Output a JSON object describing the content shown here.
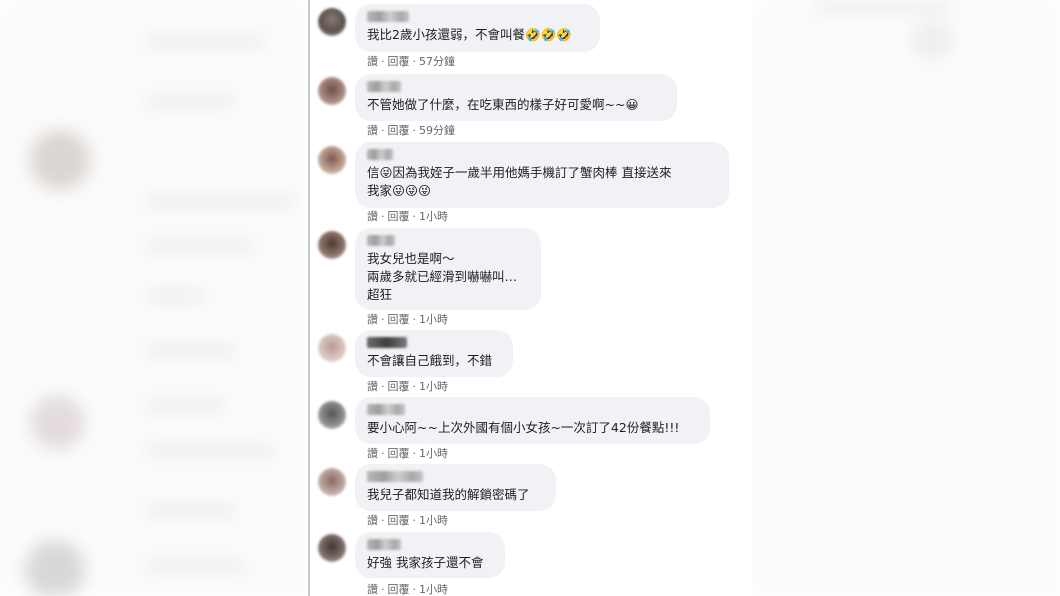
{
  "comments": [
    {
      "text": "我比2歲小孩還弱，不會叫餐🤣🤣🤣",
      "like": "讚",
      "reply": "回覆",
      "time": "57分鐘"
    },
    {
      "text": "不管她做了什麼，在吃東西的樣子好可愛啊~~😀",
      "like": "讚",
      "reply": "回覆",
      "time": "59分鐘"
    },
    {
      "text": "信😜因為我姪子一歲半用他媽手機訂了蟹肉棒 直接送來\n我家😜😜😜",
      "like": "讚",
      "reply": "回覆",
      "time": "1小時"
    },
    {
      "text": "我女兒也是啊～\n兩歲多就已經滑到嚇嚇叫…\n超狂",
      "like": "讚",
      "reply": "回覆",
      "time": "1小時"
    },
    {
      "text": "不會讓自己餓到，不錯",
      "like": "讚",
      "reply": "回覆",
      "time": "1小時"
    },
    {
      "text": "要小心阿~~上次外國有個小女孩~一次訂了42份餐點!!!",
      "like": "讚",
      "reply": "回覆",
      "time": "1小時"
    },
    {
      "text": "我兒子都知道我的解鎖密碼了",
      "like": "讚",
      "reply": "回覆",
      "time": "1小時"
    },
    {
      "text": "好強 我家孩子還不會",
      "like": "讚",
      "reply": "回覆",
      "time": "1小時"
    }
  ],
  "colors": {
    "bubble": "#f0f2f5",
    "text": "#1c1e21",
    "meta": "#65676b"
  }
}
